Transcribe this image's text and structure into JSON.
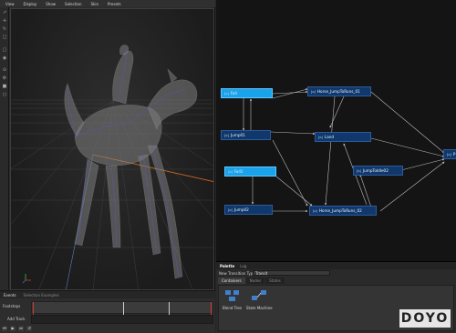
{
  "menu": [
    "View",
    "Display",
    "Show",
    "Selection",
    "Skin",
    "Presets"
  ],
  "tools": [
    "select-icon",
    "move-icon",
    "rotate-icon",
    "scale-icon",
    "frame-icon",
    "camera-icon",
    "snap-icon",
    "settings-icon",
    "lock-icon",
    "pivot-icon"
  ],
  "bottom": {
    "tabs": [
      "Events",
      "Selection Examples"
    ],
    "footsteps_label": "Footsteps",
    "add_track": "Add Track",
    "controls": [
      "⏮",
      "▶",
      "⏭",
      "↺"
    ]
  },
  "graph": {
    "nodes": {
      "fall1": "Fall",
      "hj1": "Horse_JumpToRuns_01",
      "jump01": "Jump01",
      "land": "Land",
      "fall2": "Fall1",
      "jtoidle": "JumpToIdle02",
      "jump02": "Jump02",
      "hj2": "Horse_JumpToRuns_02",
      "p": "P"
    },
    "node_icon": "[o]"
  },
  "palette": {
    "tabs": [
      "Palette",
      "Log"
    ],
    "new_transition_label": "New Transition Type",
    "new_transition_value": "Transit",
    "subtabs": [
      "Containers",
      "Nodes",
      "States"
    ],
    "items": [
      "Blend Tree",
      "State Machine"
    ]
  },
  "watermark": "DOYO",
  "colors": {
    "node_fill": "#11386a",
    "node_selected": "#1aa3ea",
    "accent_red": "#d13a2b",
    "axis_orange": "#d46a1e"
  }
}
